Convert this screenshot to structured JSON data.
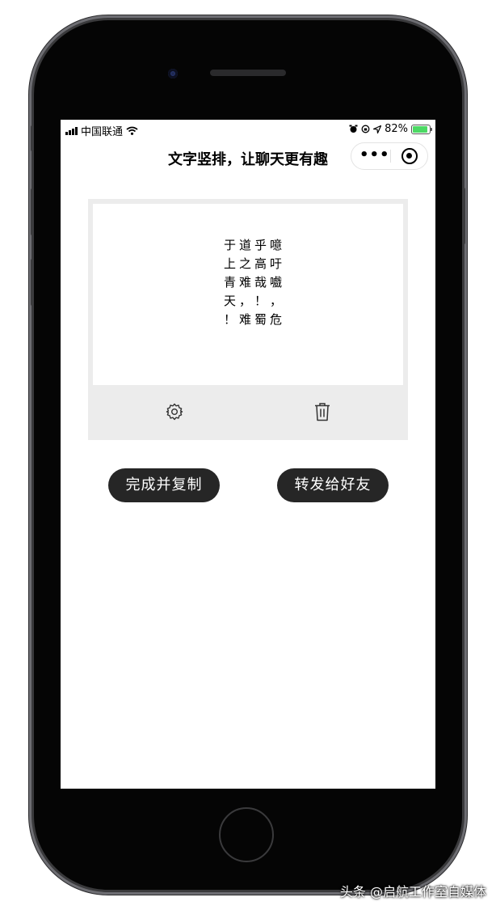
{
  "status_bar": {
    "carrier": "中国联通",
    "battery_percent": "82%",
    "signal_icon": "signal-bars-icon",
    "wifi_icon": "wifi-icon",
    "alarm_icon": "alarm-clock-icon",
    "lock_icon": "orientation-lock-icon",
    "location_icon": "location-arrow-icon",
    "battery_icon": "battery-charging-icon",
    "battery_color": "#4cd964"
  },
  "navbar": {
    "title": "文字竖排，让聊天更有趣",
    "more_label": "•••"
  },
  "editor": {
    "rows": [
      "于道乎噫",
      "上之高吁",
      "青难哉嚱",
      "天，！，",
      "！难蜀危"
    ],
    "settings_icon": "gear-icon",
    "delete_icon": "trash-icon"
  },
  "actions": {
    "copy_label": "完成并复制",
    "share_label": "转发给好友",
    "button_color": "#262626"
  },
  "watermark": "头条 @启航工作室自媒体"
}
